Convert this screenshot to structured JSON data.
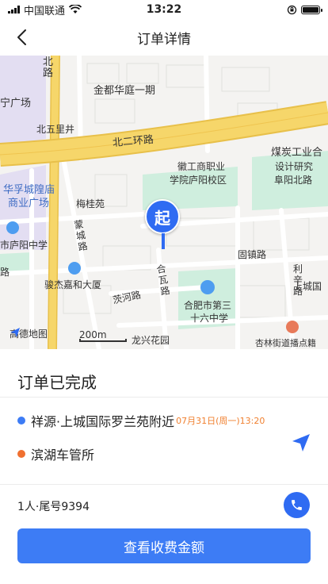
{
  "status_bar": {
    "carrier": "中国联通",
    "time": "13:22"
  },
  "header": {
    "title": "订单详情"
  },
  "map": {
    "labels": {
      "bei_lu": "北\n路",
      "jindu": "金都华庭一期",
      "ning_guangchang": "宁广场",
      "beiwulijing": "北五里井",
      "beierhuan": "北二环路",
      "meitan": "煤炭工业合",
      "sheji": "设计研究",
      "fuyang_bei": "阜阳北路",
      "gongshang_1": "徽工商职业",
      "gongshang_2": "学院庐阳校区",
      "huafu_1": "华孚城隍庙",
      "huafu_2": "商业广场",
      "meiguiyuan": "梅桂苑",
      "mengcheng": "蒙\n城\n路",
      "luyang_zhongxue": "市庐阳中学",
      "guzhen": "固镇路",
      "lixin": "利\n辛\n路",
      "shangcheng": "上城国",
      "junjie": "骏杰嘉和大厦",
      "heli": "合\n瓦\n路",
      "chahe": "茨河路",
      "shiliu_1": "合肥市第三",
      "shiliu_2": "十六中学",
      "longxing": "龙兴花园",
      "xinglin": "杏林街道播点籍",
      "lu_left": "路"
    },
    "start_label": "起",
    "logo": "高德地图",
    "scale": "200m"
  },
  "order": {
    "status": "订单已完成",
    "pickup": "祥源·上城国际罗兰苑附近",
    "pickup_time": "07月31日(周一)13:20",
    "dropoff": "滨湖车管所",
    "info": "1人·尾号9394",
    "fee_button": "查看收费金额"
  },
  "colors": {
    "accent": "#3d7cf5",
    "pickup_dot": "#3d7cf5",
    "dropoff_dot": "#f07030",
    "time_text": "#f08030",
    "highway": "#f6d66a"
  },
  "icons": {
    "back": "chevron-left-icon",
    "navigate": "navigation-arrow-icon",
    "phone": "phone-icon"
  }
}
